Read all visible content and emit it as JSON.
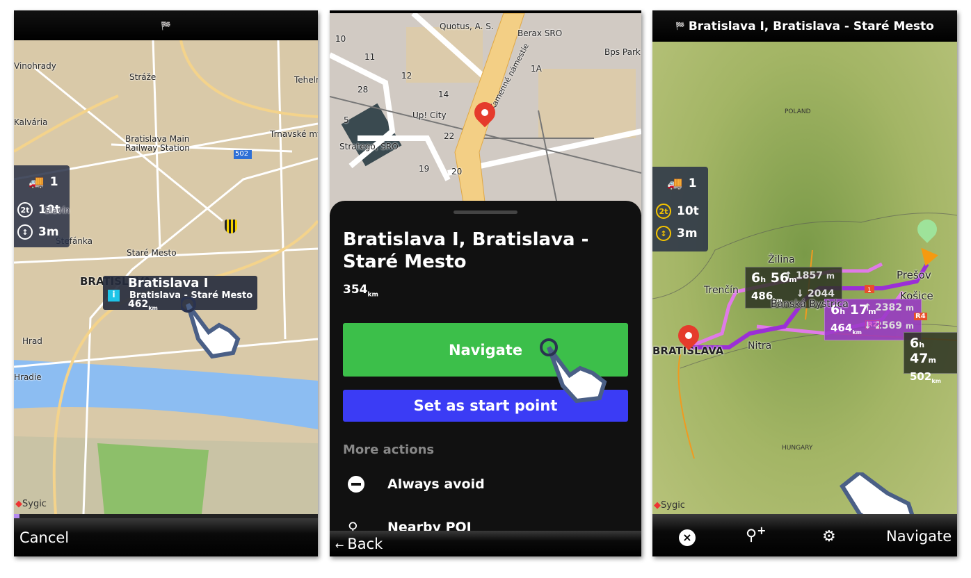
{
  "panel1": {
    "top_icon": "checkered-flag-icon",
    "map_labels": [
      "Vinohrady",
      "Stráže",
      "Tehelné",
      "Kalvária",
      "Bratislava Main Railway Station",
      "Trnavské mýto",
      "502",
      "Slavín",
      "Štefánka",
      "Staré Mesto",
      "BRATISLAVA",
      "Hrad",
      "Hradie"
    ],
    "truck": {
      "axles": "1",
      "weight": "10t",
      "weight_badge": "2t",
      "height": "3m"
    },
    "popup": {
      "title": "Bratislava I",
      "subtitle": "Bratislava - Staré Mesto",
      "distance": "462",
      "distance_unit": "km"
    },
    "logo": "Sygic",
    "cancel_label": "Cancel"
  },
  "panel2": {
    "map_labels": [
      "Quotus, A. S.",
      "Berax SRO",
      "Bps Park",
      "10",
      "11",
      "12",
      "14",
      "28",
      "5",
      "1A",
      "Up! City",
      "Kamenné námestie",
      "Stratego, SRO",
      "22",
      "19",
      "20"
    ],
    "sheet": {
      "title": "Bratislava I, Bratislava - Staré Mesto",
      "distance": "354",
      "distance_unit": "km",
      "navigate_label": "Navigate",
      "start_point_label": "Set as start point",
      "more_actions_label": "More actions",
      "actions": [
        {
          "label": "Always avoid",
          "icon": "minus-circle-icon"
        },
        {
          "label": "Nearby POI",
          "icon": "search-icon"
        }
      ]
    },
    "back_label": "Back",
    "colors": {
      "navigate": "#3cbf4a",
      "start_point": "#3b3cf5"
    }
  },
  "panel3": {
    "title": "Bratislava I, Bratislava - Staré Mesto",
    "map_labels": [
      "POLAND",
      "Žilina",
      "Trenčín",
      "Banská Bystrica",
      "Nitra",
      "Prešov",
      "Košice",
      "BRATISLAVA",
      "HUNGARY"
    ],
    "truck": {
      "axles": "1",
      "weight": "10t",
      "weight_badge": "2t",
      "height": "3m"
    },
    "routes": [
      {
        "time_h": "6",
        "time_m": "56",
        "distance": "486",
        "ascent": "1857",
        "descent": "2044"
      },
      {
        "time_h": "6",
        "time_m": "17",
        "distance": "464",
        "ascent": "2382",
        "descent": "2569"
      },
      {
        "time_h": "6",
        "time_m": "47",
        "distance": "502"
      }
    ],
    "road_badges": [
      "1",
      "R2",
      "R4"
    ],
    "logo": "Sygic",
    "toolbar": {
      "cancel_icon": "close-circle-icon",
      "add_waypoint_icon": "add-location-icon",
      "settings_icon": "gear-icon",
      "navigate_label": "Navigate"
    },
    "colors": {
      "route_selected": "#9b2fd6",
      "route_alt": "#e07ae8"
    }
  }
}
